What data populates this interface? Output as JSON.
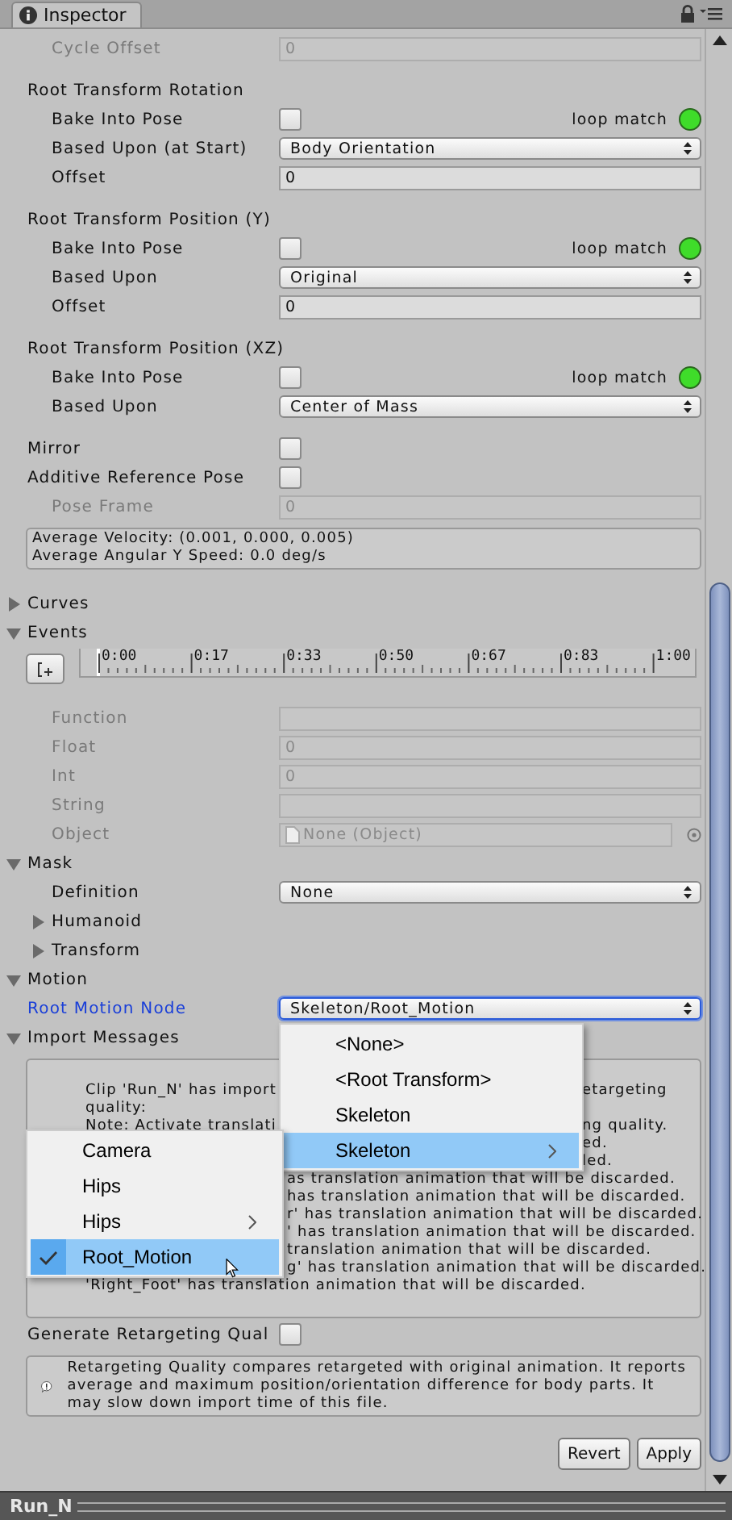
{
  "tab": {
    "title": "Inspector"
  },
  "rows": [
    {
      "kind": "group",
      "children": [
        {
          "kind": "field",
          "label": "Cycle Offset",
          "value": "0",
          "disabled": true
        }
      ]
    },
    {
      "kind": "header",
      "label": "Root Transform Rotation",
      "children": [
        {
          "kind": "checkbox",
          "label": "Bake Into Pose",
          "checked": false,
          "loop_match": {
            "label": "loop match",
            "matched": true
          }
        },
        {
          "kind": "dropdown",
          "label": "Based Upon (at Start)",
          "value": "Body Orientation",
          "focused": false
        },
        {
          "kind": "field",
          "label": "Offset",
          "value": "0",
          "disabled": false
        }
      ]
    },
    {
      "kind": "header",
      "label": "Root Transform Position (Y)",
      "children": [
        {
          "kind": "checkbox",
          "label": "Bake Into Pose",
          "checked": false,
          "loop_match": {
            "label": "loop match",
            "matched": true
          }
        },
        {
          "kind": "dropdown",
          "label": "Based Upon",
          "value": "Original",
          "focused": false
        },
        {
          "kind": "field",
          "label": "Offset",
          "value": "0",
          "disabled": false
        }
      ]
    },
    {
      "kind": "header",
      "label": "Root Transform Position (XZ)",
      "children": [
        {
          "kind": "checkbox",
          "label": "Bake Into Pose",
          "checked": false,
          "loop_match": {
            "label": "loop match",
            "matched": true
          }
        },
        {
          "kind": "dropdown",
          "label": "Based Upon",
          "value": "Center of Mass",
          "focused": false
        }
      ]
    },
    {
      "kind": "checkbox",
      "label": "Mirror",
      "checked": false
    },
    {
      "kind": "checkbox",
      "label": "Additive Reference Pose",
      "checked": false,
      "children": [
        {
          "kind": "field",
          "label": "Pose Frame",
          "value": "0",
          "disabled": true
        }
      ]
    },
    {
      "kind": "info",
      "lines": [
        "Average Velocity: (0.001, 0.000, 0.005)",
        "Average Angular Y Speed: 0.0 deg/s"
      ]
    },
    {
      "kind": "foldout",
      "label": "Curves",
      "expanded": false
    },
    {
      "kind": "foldout",
      "label": "Events",
      "expanded": true,
      "children": [
        {
          "kind": "timeline",
          "ticks": [
            "0:00",
            "0:17",
            "0:33",
            "0:50",
            "0:67",
            "0:83",
            "1:00"
          ]
        },
        {
          "kind": "field",
          "label": "Function",
          "disabled": true
        },
        {
          "kind": "field",
          "label": "Float",
          "value": "0",
          "disabled": true
        },
        {
          "kind": "field",
          "label": "Int",
          "value": "0",
          "disabled": true
        },
        {
          "kind": "field",
          "label": "String",
          "disabled": true
        },
        {
          "kind": "object",
          "label": "Object",
          "value": "None (Object)",
          "disabled": true
        }
      ]
    },
    {
      "kind": "foldout",
      "label": "Mask",
      "expanded": true,
      "children": [
        {
          "kind": "dropdown",
          "label": "Definition",
          "value": "None",
          "focused": false
        },
        {
          "kind": "foldout",
          "label": "Humanoid",
          "expanded": false
        },
        {
          "kind": "foldout",
          "label": "Transform",
          "expanded": false
        }
      ]
    },
    {
      "kind": "foldout",
      "label": "Motion",
      "expanded": true
    },
    {
      "kind": "dropdown",
      "label": "Root Motion Node",
      "value": "Skeleton/Root_Motion",
      "focused": true
    },
    {
      "kind": "foldout",
      "label": "Import Messages",
      "expanded": true
    }
  ],
  "import_messages": {
    "lines": [
      {
        "text": "Clip 'Run_N' has import",
        "after_menu": "etargeting"
      },
      {
        "text": "quality:"
      },
      {
        "text": "Note: Activate translati",
        "after_menu": "ng quality."
      },
      {
        "after_menu": "ed."
      },
      {
        "after_menu": "led."
      },
      {
        "after_submenu": "as translation animation that will be discarded."
      },
      {
        "after_submenu": "has translation animation that will be discarded."
      },
      {
        "after_submenu": "r' has translation animation that will be discarded."
      },
      {
        "after_submenu": "' has translation animation that will be discarded."
      },
      {
        "after_submenu": "translation animation that will be discarded."
      },
      {
        "after_submenu": "g' has translation animation that will be discarded."
      },
      {
        "text": "'Right_Foot' has translation animation that will be discarded."
      }
    ]
  },
  "root_motion_menu": {
    "items": [
      {
        "label": "<None>",
        "selected": false,
        "submenu": false
      },
      {
        "label": "<Root Transform>",
        "selected": false,
        "submenu": false
      },
      {
        "label": "Skeleton",
        "selected": false,
        "submenu": false
      },
      {
        "label": "Skeleton",
        "selected": true,
        "submenu": true
      }
    ]
  },
  "submenu": {
    "items": [
      {
        "label": "Camera",
        "selected": false,
        "checked": false,
        "submenu": false
      },
      {
        "label": "Hips",
        "selected": false,
        "checked": false,
        "submenu": false
      },
      {
        "label": "Hips",
        "selected": false,
        "checked": false,
        "submenu": true
      },
      {
        "label": "Root_Motion",
        "selected": true,
        "checked": true,
        "submenu": false
      }
    ]
  },
  "retargeting": {
    "label": "Generate Retargeting Qual",
    "checked": false
  },
  "note": {
    "text": "Retargeting Quality compares retargeted with original animation. It reports average and maximum position/orientation difference for body parts. It may slow down import time of this file."
  },
  "buttons": [
    "Revert",
    "Apply"
  ],
  "status_bar": {
    "title": "Run_N"
  }
}
